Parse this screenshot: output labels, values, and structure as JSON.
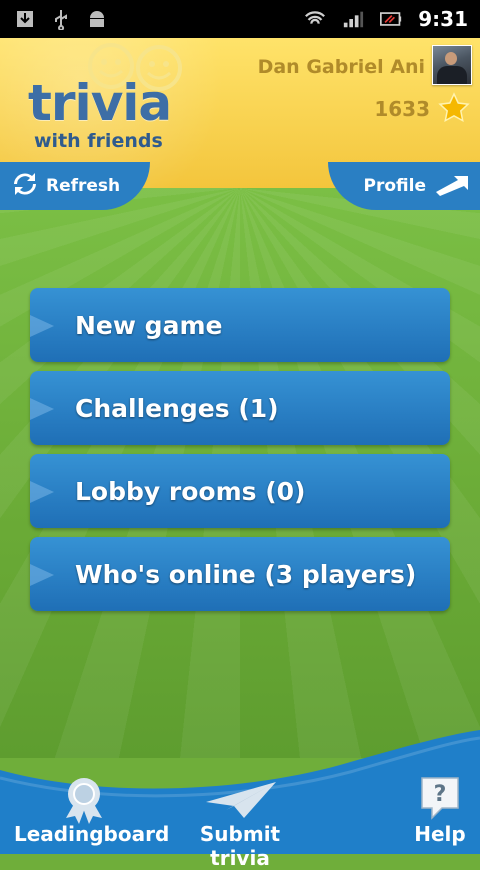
{
  "status_bar": {
    "time": "9:31",
    "icons_left": [
      "download-icon",
      "usb-icon",
      "android-debug-icon"
    ],
    "icons_right": [
      "wifi-icon",
      "signal-icon",
      "battery-icon"
    ]
  },
  "header": {
    "logo_title": "trivia",
    "logo_subtitle": "with friends",
    "user_name": "Dan Gabriel Ani",
    "score": "1633",
    "refresh_label": "Refresh",
    "profile_label": "Profile"
  },
  "menu": {
    "items": [
      {
        "label": "New game"
      },
      {
        "label": "Challenges (1)"
      },
      {
        "label": "Lobby rooms (0)"
      },
      {
        "label": "Who's online (3 players)"
      }
    ]
  },
  "bottom_bar": {
    "leaderboard_label": "Leadingboard",
    "submit_label": "Submit trivia",
    "help_label": "Help"
  },
  "colors": {
    "header_yellow": "#f3c53c",
    "button_blue": "#2a7fc3",
    "background_green": "#6fae3a"
  }
}
